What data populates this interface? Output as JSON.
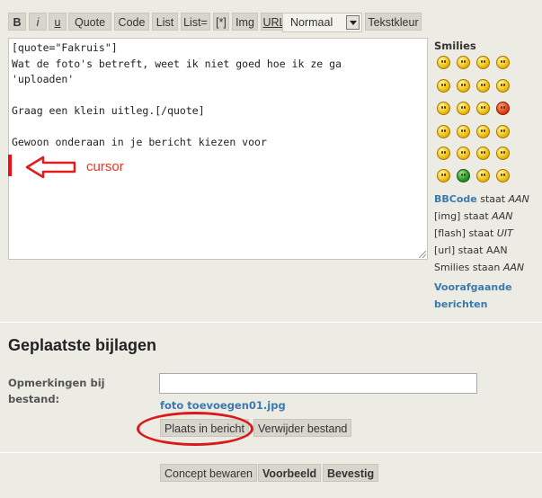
{
  "toolbar": {
    "buttons": [
      {
        "label": "B"
      },
      {
        "label": "i"
      },
      {
        "label": "u"
      },
      {
        "label": "Quote"
      },
      {
        "label": "Code"
      },
      {
        "label": "List"
      },
      {
        "label": "List="
      },
      {
        "label": "[*]"
      },
      {
        "label": "Img"
      },
      {
        "label": "URL"
      }
    ],
    "font_size_select": "Normaal",
    "text_color_button": "Tekstkleur"
  },
  "editor": {
    "content": "[quote=\"Fakruis\"]\nWat de foto's betreft, weet ik niet goed hoe ik ze ga\n'uploaden'\n\nGraag een klein uitleg.[/quote]\n\nGewoon onderaan in je bericht kiezen voor"
  },
  "annotation": {
    "cursor_label": "cursor",
    "color": "#e11a1a"
  },
  "smilies": {
    "title": "Smilies"
  },
  "side_info": {
    "bbcode_link": "BBCode",
    "bbcode_status": " staat ",
    "bbcode_value": "AAN",
    "img_status": "[img] staat ",
    "img_value": "AAN",
    "flash_status": "[flash] staat ",
    "flash_value": "UIT",
    "url_status": "[url] staat AAN",
    "smilies_status": "Smilies staan ",
    "smilies_value": "AAN",
    "previous_posts_line1": "Voorafgaande",
    "previous_posts_line2": "berichten"
  },
  "attachments": {
    "heading": "Geplaatste bijlagen",
    "comment_label": "Opmerkingen bij bestand:",
    "file_name": "foto toevoegen01.jpg",
    "place_button": "Plaats in bericht",
    "delete_button": "Verwijder bestand"
  },
  "actions": {
    "save_draft": "Concept bewaren",
    "preview": "Voorbeeld",
    "confirm": "Bevestig"
  }
}
